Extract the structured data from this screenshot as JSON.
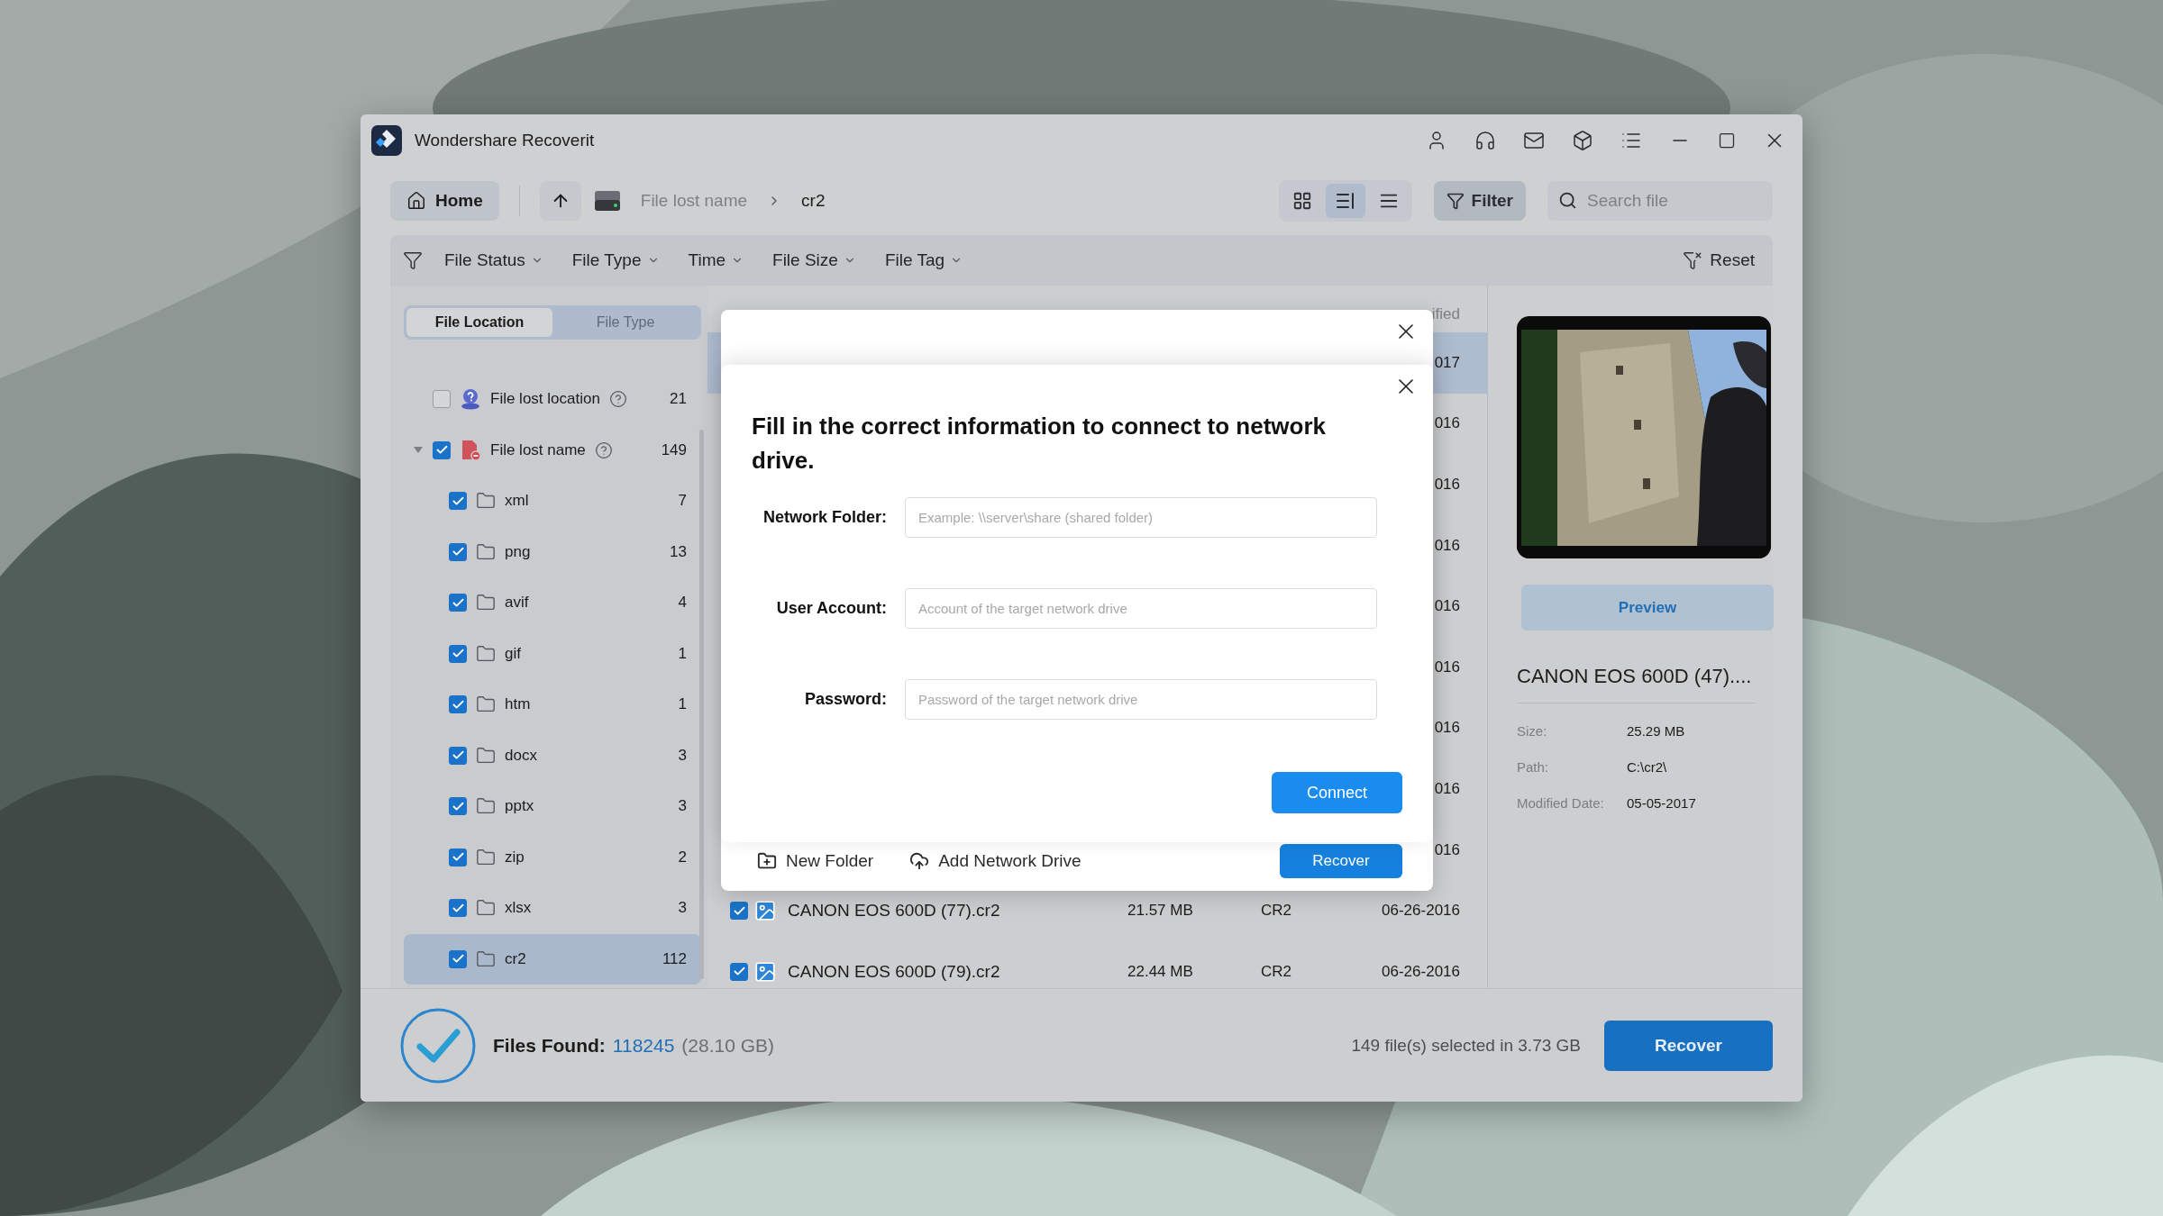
{
  "window": {
    "title": "Wondershare Recoverit"
  },
  "toolbar": {
    "home": "Home",
    "breadcrumb": [
      {
        "label": "File lost name",
        "current": false
      },
      {
        "label": "cr2",
        "current": true
      }
    ],
    "views": [
      {
        "kind": "grid",
        "selected": false
      },
      {
        "kind": "detail",
        "selected": true
      },
      {
        "kind": "list",
        "selected": false
      }
    ],
    "filter_button": {
      "label": "Filter",
      "active": true
    },
    "search": {
      "placeholder": "Search file"
    }
  },
  "filters": {
    "items": [
      "File Status",
      "File Type",
      "Time",
      "File Size",
      "File Tag"
    ],
    "reset": "Reset"
  },
  "sidebar": {
    "tabs": [
      {
        "label": "File Location",
        "selected": true
      },
      {
        "label": "File Type",
        "selected": false
      }
    ],
    "tree": [
      {
        "kind": "location",
        "label": "File lost location",
        "count": "21",
        "checked": false,
        "selected": false
      },
      {
        "kind": "lost-name",
        "label": "File lost name",
        "count": "149",
        "checked": true,
        "selected": false,
        "expanded": true,
        "children": [
          {
            "kind": "folder",
            "label": "xml",
            "count": "7",
            "checked": true,
            "selected": false
          },
          {
            "kind": "folder",
            "label": "png",
            "count": "13",
            "checked": true,
            "selected": false
          },
          {
            "kind": "folder",
            "label": "avif",
            "count": "4",
            "checked": true,
            "selected": false
          },
          {
            "kind": "folder",
            "label": "gif",
            "count": "1",
            "checked": true,
            "selected": false
          },
          {
            "kind": "folder",
            "label": "htm",
            "count": "1",
            "checked": true,
            "selected": false
          },
          {
            "kind": "folder",
            "label": "docx",
            "count": "3",
            "checked": true,
            "selected": false
          },
          {
            "kind": "folder",
            "label": "pptx",
            "count": "3",
            "checked": true,
            "selected": false
          },
          {
            "kind": "folder",
            "label": "zip",
            "count": "2",
            "checked": true,
            "selected": false
          },
          {
            "kind": "folder",
            "label": "xlsx",
            "count": "3",
            "checked": true,
            "selected": false
          },
          {
            "kind": "folder",
            "label": "cr2",
            "count": "112",
            "checked": true,
            "selected": true
          }
        ]
      }
    ]
  },
  "file_list": {
    "header": "ified",
    "rows": [
      {
        "kind": "covered",
        "date": "017",
        "selected": true
      },
      {
        "kind": "covered",
        "date": "016",
        "selected": false
      },
      {
        "kind": "covered",
        "date": "016",
        "selected": false
      },
      {
        "kind": "covered",
        "date": "016",
        "selected": false
      },
      {
        "kind": "covered",
        "date": "016",
        "selected": false
      },
      {
        "kind": "covered",
        "date": "016",
        "selected": false
      },
      {
        "kind": "covered",
        "date": "016",
        "selected": false
      },
      {
        "kind": "covered",
        "date": "016",
        "selected": false
      },
      {
        "kind": "covered",
        "date": "016",
        "selected": false
      },
      {
        "kind": "file",
        "name": "CANON EOS 600D (77).cr2",
        "size": "21.57 MB",
        "type": "CR2",
        "date": "06-26-2016",
        "checked": true,
        "selected": false
      },
      {
        "kind": "file",
        "name": "CANON EOS 600D (79).cr2",
        "size": "22.44 MB",
        "type": "CR2",
        "date": "06-26-2016",
        "checked": true,
        "selected": false
      }
    ]
  },
  "preview": {
    "button": "Preview",
    "file_name": "CANON EOS 600D (47)....",
    "details": [
      {
        "label": "Size:",
        "value": "25.29 MB"
      },
      {
        "label": "Path:",
        "value": "C:\\cr2\\"
      },
      {
        "label": "Modified Date:",
        "value": "05-05-2017"
      }
    ]
  },
  "status_bar": {
    "found_label": "Files Found:",
    "found_count": "118245",
    "found_size": "(28.10 GB)",
    "selection": "149 file(s) selected in 3.73 GB",
    "recover": "Recover"
  },
  "back_dialog": {
    "actions": [
      {
        "kind": "new-folder",
        "label": "New Folder"
      },
      {
        "kind": "network",
        "label": "Add Network Drive"
      }
    ],
    "button": "Recover"
  },
  "dialog": {
    "title": "Fill in the correct information to connect to network drive.",
    "fields": [
      {
        "label": "Network Folder:",
        "placeholder": "Example: \\\\server\\share (shared folder)"
      },
      {
        "label": "User Account:",
        "placeholder": "Account of the target network drive"
      },
      {
        "label": "Password:",
        "placeholder": "Password of the target network drive"
      }
    ],
    "button": "Connect"
  }
}
